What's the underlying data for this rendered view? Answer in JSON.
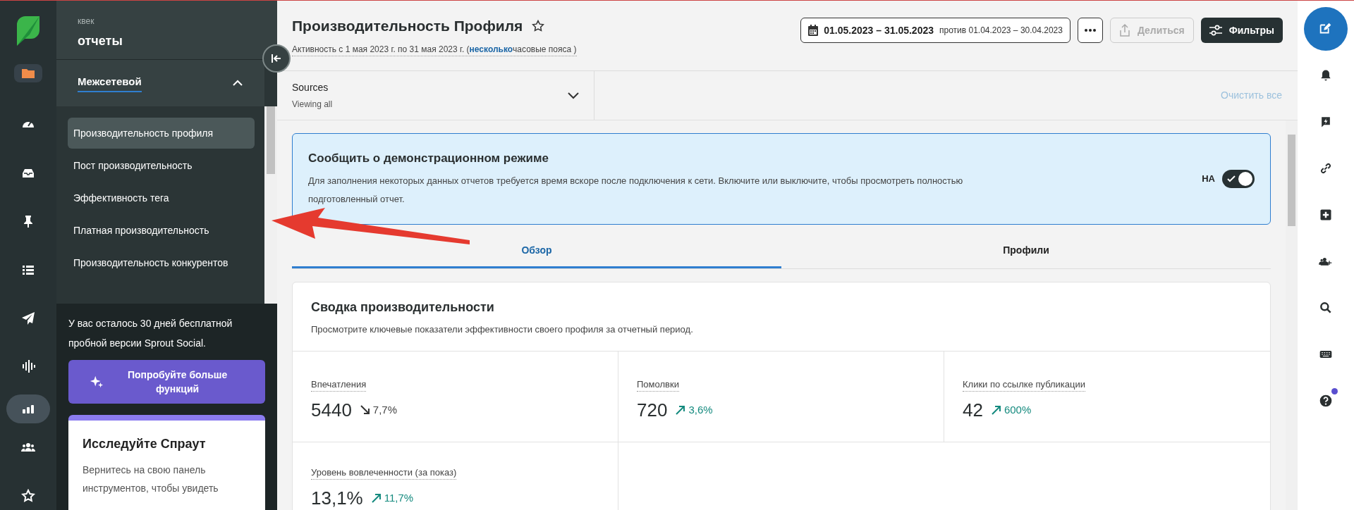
{
  "rail": {
    "items": [
      {
        "selected": true
      },
      {
        "selected": false
      },
      {
        "selected": false
      },
      {
        "selected": false
      },
      {
        "selected": false
      },
      {
        "selected": false
      },
      {
        "selected": false
      },
      {
        "selected": true
      },
      {
        "selected": false
      },
      {
        "selected": false
      }
    ]
  },
  "nav": {
    "org": "квек",
    "title": "отчеты",
    "section": {
      "label": "Межсетевой",
      "expanded": true
    },
    "items": [
      {
        "label": "Производительность профиля",
        "selected": true
      },
      {
        "label": "Пост производительность",
        "selected": false
      },
      {
        "label": "Эффективность тега",
        "selected": false
      },
      {
        "label": "Платная производительность",
        "selected": false
      },
      {
        "label": "Производительность конкурентов",
        "selected": false
      }
    ]
  },
  "trial": {
    "text": "У вас осталось 30 дней бесплатной пробной версии Sprout Social.",
    "button": "Попробуйте больше функций",
    "card": {
      "title": "Исследуйте Спраут",
      "text": "Вернитесь на свою панель инструментов, чтобы увидеть"
    }
  },
  "header": {
    "title": "Производительность Профиля",
    "subtitle_prefix": "Активность с 1 мая 2023 г. по 31 мая 2023 г. (",
    "subtitle_link": "несколько",
    "subtitle_suffix": "часовые пояса )",
    "date_range": "01.05.2023 – 31.05.2023",
    "compare": "против 01.04.2023 – 30.04.2023",
    "share": {
      "label": "Делиться",
      "disabled": true
    },
    "filters": "Фильтры"
  },
  "sources": {
    "label": "Sources",
    "value": "Viewing all",
    "clear": "Очистить все"
  },
  "banner": {
    "title": "Сообщить о демонстрационном режиме",
    "text": "Для заполнения некоторых данных отчетов требуется время вскоре после подключения к сети. Включите или выключите, чтобы просмотреть полностью подготовленный отчет.",
    "toggle": {
      "label": "НА",
      "on": true
    }
  },
  "tabs": [
    {
      "label": "Обзор",
      "selected": true
    },
    {
      "label": "Профили",
      "selected": false
    }
  ],
  "summary": {
    "title": "Сводка производительности",
    "subtitle": "Просмотрите ключевые показатели эффективности своего профиля за отчетный период.",
    "metrics": [
      {
        "label": "Впечатления",
        "value": "5440",
        "change": "7,7%",
        "rising": false
      },
      {
        "label": "Помолвки",
        "value": "720",
        "change": "3,6%",
        "rising": true
      },
      {
        "label": "Клики по ссылке публикации",
        "value": "42",
        "change": "600%",
        "rising": true
      },
      {
        "label": "Уровень вовлеченности (за показ)",
        "value": "13,1%",
        "change": "11,7%",
        "rising": true
      }
    ]
  },
  "right_rail": {
    "items": [
      {
        "badge": false
      },
      {
        "badge": false
      },
      {
        "badge": false
      },
      {
        "badge": false
      },
      {
        "badge": false
      },
      {
        "badge": false
      },
      {
        "badge": false
      },
      {
        "badge": false
      },
      {
        "badge": true
      }
    ]
  }
}
